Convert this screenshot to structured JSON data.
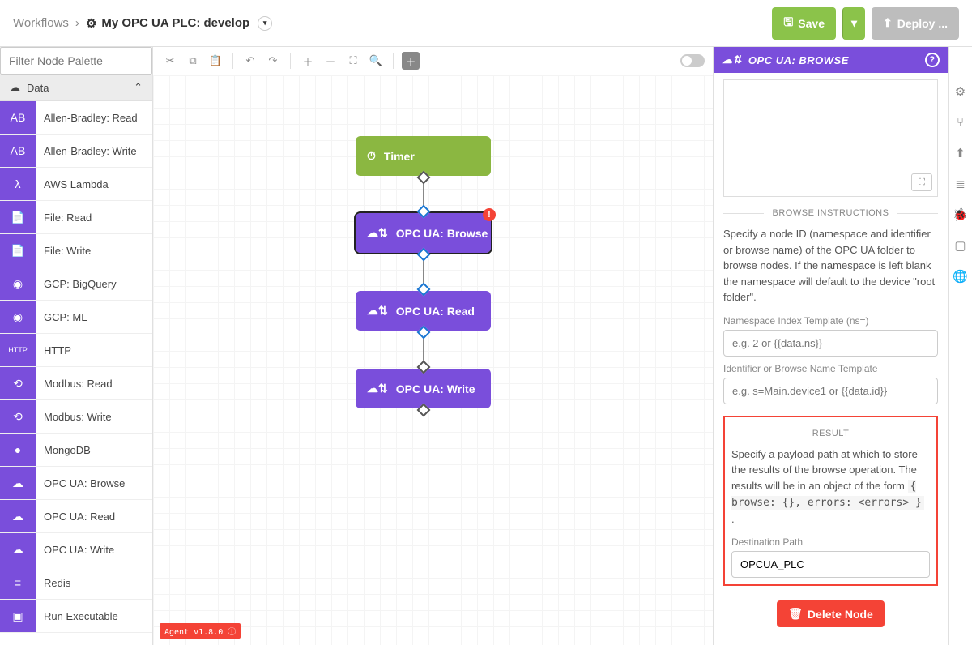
{
  "header": {
    "breadcrumb_root": "Workflows",
    "breadcrumb_sep": "›",
    "title": "My OPC UA PLC: develop",
    "save_label": "Save",
    "deploy_label": "Deploy ..."
  },
  "palette": {
    "filter_placeholder": "Filter Node Palette",
    "category": "Data",
    "nodes": [
      {
        "label": "Allen-Bradley: Read"
      },
      {
        "label": "Allen-Bradley: Write"
      },
      {
        "label": "AWS Lambda"
      },
      {
        "label": "File: Read"
      },
      {
        "label": "File: Write"
      },
      {
        "label": "GCP: BigQuery"
      },
      {
        "label": "GCP: ML"
      },
      {
        "label": "HTTP"
      },
      {
        "label": "Modbus: Read"
      },
      {
        "label": "Modbus: Write"
      },
      {
        "label": "MongoDB"
      },
      {
        "label": "OPC UA: Browse"
      },
      {
        "label": "OPC UA: Read"
      },
      {
        "label": "OPC UA: Write"
      },
      {
        "label": "Redis"
      },
      {
        "label": "Run Executable"
      }
    ]
  },
  "canvas": {
    "nodes": [
      {
        "label": "Timer"
      },
      {
        "label": "OPC UA: Browse"
      },
      {
        "label": "OPC UA: Read"
      },
      {
        "label": "OPC UA: Write"
      }
    ],
    "agent_badge": "Agent v1.8.0 ⓘ"
  },
  "inspector": {
    "title": "OPC UA: BROWSE",
    "browse_heading": "BROWSE INSTRUCTIONS",
    "browse_desc": "Specify a node ID (namespace and identifier or browse name) of the OPC UA folder to browse nodes. If the namespace is left blank the namespace will default to the device \"root folder\".",
    "ns_label": "Namespace Index Template (ns=)",
    "ns_placeholder": "e.g. 2 or {{data.ns}}",
    "id_label": "Identifier or Browse Name Template",
    "id_placeholder": "e.g. s=Main.device1 or {{data.id}}",
    "result_heading": "RESULT",
    "result_desc_pre": "Specify a payload path at which to store the results of the browse operation. The results will be in an object of the form ",
    "result_desc_code": "{ browse: {}, errors: <errors> }",
    "result_desc_post": " .",
    "dest_label": "Destination Path",
    "dest_value": "OPCUA_PLC",
    "delete_label": "Delete Node"
  }
}
